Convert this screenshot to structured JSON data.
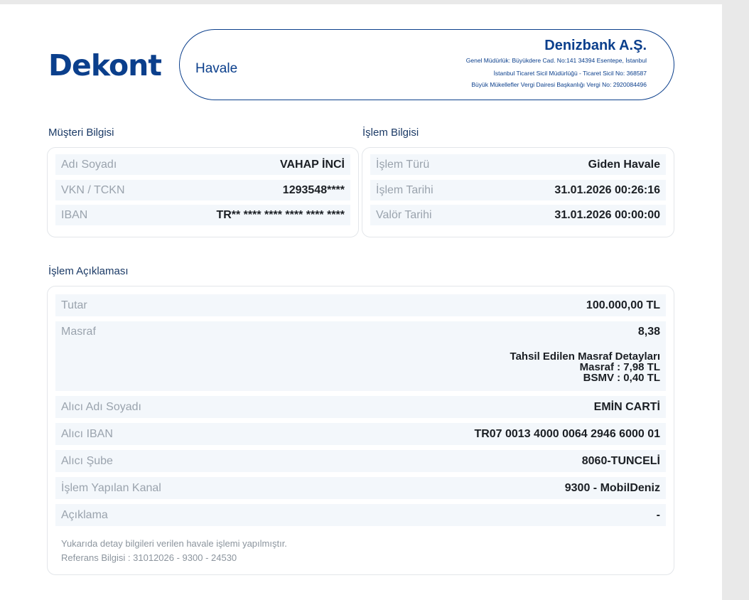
{
  "header": {
    "title": "Dekont",
    "doc_type": "Havale",
    "bank_name": "Denizbank A.Ş.",
    "bank_lines": [
      "Genel Müdürlük: Büyükdere Cad. No:141 34394 Esentepe, İstanbul",
      "İstanbul Ticaret Sicil Müdürlüğü - Ticaret Sicil No: 368587",
      "Büyük Mükellefler Vergi Dairesi Başkanlığı Vergi No: 2920084496"
    ]
  },
  "customer": {
    "title": "Müşteri Bilgisi",
    "rows": [
      {
        "label": "Adı Soyadı",
        "value": "VAHAP İNCİ"
      },
      {
        "label": "VKN / TCKN",
        "value": "1293548****"
      },
      {
        "label": "IBAN",
        "value": "TR** **** **** **** **** ****"
      }
    ]
  },
  "transaction": {
    "title": "İşlem Bilgisi",
    "rows": [
      {
        "label": "İşlem Türü",
        "value": "Giden Havale"
      },
      {
        "label": "İşlem Tarihi",
        "value": "31.01.2026 00:26:16"
      },
      {
        "label": "Valör Tarihi",
        "value": "31.01.2026 00:00:00"
      }
    ]
  },
  "description": {
    "title": "İşlem Açıklaması",
    "amount": {
      "label": "Tutar",
      "value": "100.000,00  TL"
    },
    "fee": {
      "label": "Masraf",
      "value": "8,38",
      "detail_title": "Tahsil Edilen Masraf Detayları",
      "detail_fee": "Masraf   : 7,98 TL",
      "detail_bsmv": "BSMV   : 0,40 TL"
    },
    "rows": [
      {
        "label": "Alıcı Adı Soyadı",
        "value": "EMİN CARTİ"
      },
      {
        "label": "Alıcı IBAN",
        "value": "TR07 0013 4000 0064 2946 6000 01"
      },
      {
        "label": "Alıcı Şube",
        "value": "8060-TUNCELİ"
      },
      {
        "label": "İşlem Yapılan Kanal",
        "value": "9300 - MobilDeniz"
      },
      {
        "label": "Açıklama",
        "value": "-"
      }
    ],
    "note_line1": "Yukarıda detay bilgileri verilen havale işlemi yapılmıştır.",
    "note_line2": "Referans Bilgisi : 31012026 - 9300 - 24530"
  },
  "colors": {
    "brand": "#0b3f8c",
    "row_bg": "#f3f7fb",
    "label": "#9aa3ad",
    "value": "#1b1f24"
  }
}
